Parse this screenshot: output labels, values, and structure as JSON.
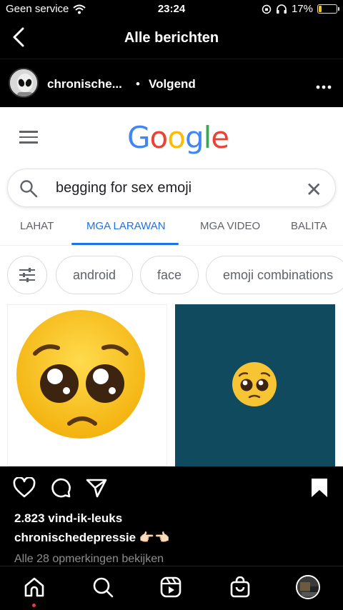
{
  "status_bar": {
    "carrier": "Geen service",
    "time": "23:24",
    "battery_percent": "17%",
    "battery_level": 0.17,
    "icons": [
      "wifi-icon",
      "orientation-lock-icon",
      "headphones-icon",
      "battery-icon"
    ]
  },
  "nav": {
    "title": "Alle berichten",
    "back_icon": "chevron-left-icon"
  },
  "post_header": {
    "username": "chronische...",
    "separator": "•",
    "follow_label": "Volgend",
    "more_icon": "more-horizontal-icon"
  },
  "screenshot": {
    "logo_letters": [
      "G",
      "o",
      "o",
      "g",
      "l",
      "e"
    ],
    "logo_colors": [
      "#4285F4",
      "#EA4335",
      "#FBBC05",
      "#4285F4",
      "#34A853",
      "#EA4335"
    ],
    "search_query": "begging for sex emoji",
    "tabs": [
      {
        "label": "LAHAT"
      },
      {
        "label": "MGA LARAWAN",
        "active": true
      },
      {
        "label": "MGA VIDEO"
      },
      {
        "label": "BALITA"
      }
    ],
    "chips": [
      "android",
      "face",
      "emoji combinations"
    ],
    "result_bg_color": "#0f4a5f"
  },
  "actions": {
    "icons": [
      "heart-icon",
      "comment-icon",
      "share-icon",
      "bookmark-icon"
    ]
  },
  "likes": "2.823 vind-ik-leuks",
  "caption": {
    "username": "chronischedepressie",
    "text": "👉🏻👈🏻"
  },
  "comments_link": "Alle 28 opmerkingen bekijken",
  "bottom_nav": {
    "items": [
      "home-icon",
      "search-icon",
      "reels-icon",
      "shop-icon",
      "profile-avatar"
    ],
    "active": "home-icon"
  }
}
